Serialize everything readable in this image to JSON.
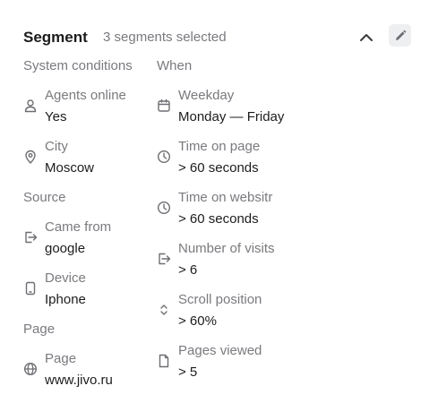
{
  "header": {
    "title": "Segment",
    "subtitle": "3 segments selected"
  },
  "icons": {
    "collapse": "chevron-up-icon",
    "edit": "pencil-icon"
  },
  "left_column": {
    "system_conditions": {
      "title": "System conditions",
      "items": [
        {
          "label": "Agents online",
          "value": "Yes",
          "icon": "person-icon"
        },
        {
          "label": "City",
          "value": "Moscow",
          "icon": "location-pin-icon"
        }
      ]
    },
    "source": {
      "title": "Source",
      "items": [
        {
          "label": "Came from",
          "value": "google",
          "icon": "sign-in-icon"
        },
        {
          "label": "Device",
          "value": "Iphone",
          "icon": "phone-icon"
        }
      ]
    },
    "page": {
      "title": "Page",
      "items": [
        {
          "label": "Page",
          "value": "www.jivo.ru",
          "icon": "globe-icon"
        }
      ]
    }
  },
  "right_column": {
    "when": {
      "title": "When",
      "items": [
        {
          "label": "Weekday",
          "value": "Monday — Friday",
          "icon": "calendar-icon"
        },
        {
          "label": "Time on page",
          "value": "> 60 seconds",
          "icon": "clock-icon"
        },
        {
          "label": "Time on websitr",
          "value": "> 60 seconds",
          "icon": "clock-icon"
        },
        {
          "label": "Number of visits",
          "value": "> 6",
          "icon": "sign-in-icon"
        },
        {
          "label": "Scroll position",
          "value": "> 60%",
          "icon": "scroll-arrows-icon"
        },
        {
          "label": "Pages viewed",
          "value": "> 5",
          "icon": "document-icon"
        }
      ]
    }
  },
  "colors": {
    "text_primary": "#1c1c1e",
    "text_secondary": "#7a7a7f",
    "icon": "#6e6e73",
    "edit_button_bg": "#eeeff1"
  }
}
